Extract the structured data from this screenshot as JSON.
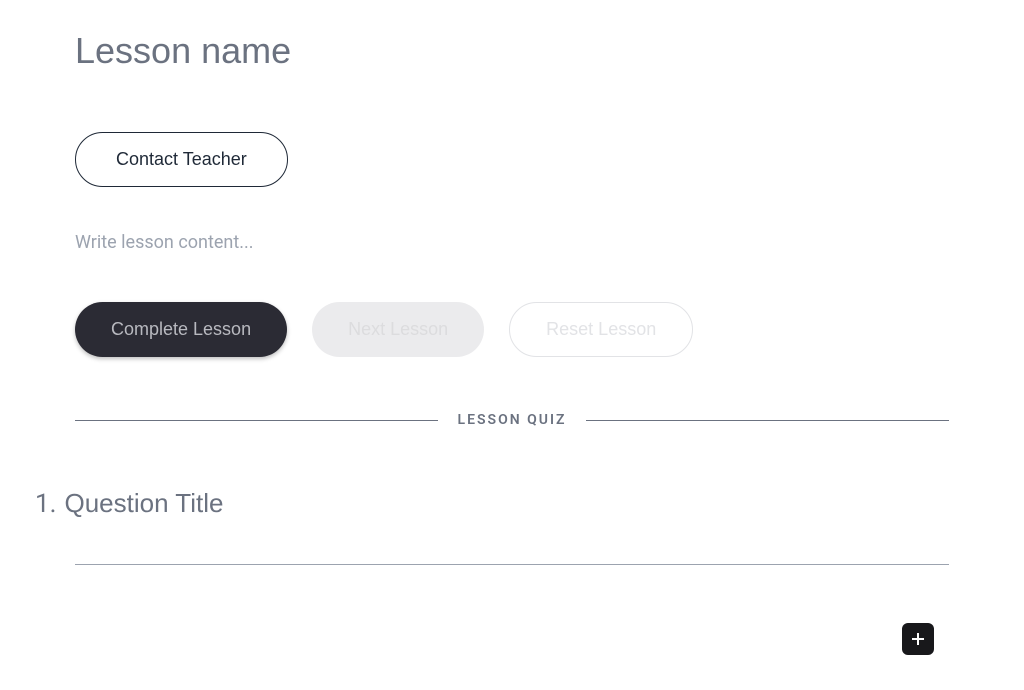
{
  "lesson": {
    "title_placeholder": "Lesson name",
    "contact_button_label": "Contact Teacher",
    "content_placeholder": "Write lesson content...",
    "actions": {
      "complete": "Complete Lesson",
      "next": "Next Lesson",
      "reset": "Reset Lesson"
    },
    "quiz_divider_label": "LESSON QUIZ",
    "questions": [
      {
        "number": "1.",
        "title_placeholder": "Question Title"
      }
    ]
  }
}
